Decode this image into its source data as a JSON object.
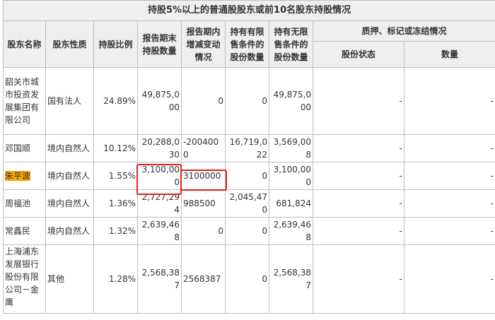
{
  "table": {
    "title": "持股5%以上的普通股股东或前10名股东持股情况",
    "headers": {
      "name": "股东名称",
      "nature": "股东性质",
      "ratio": "持股比例",
      "period_end": "报告期末持股数量",
      "change": "报告期内增减变动情况",
      "restricted": "持有有限售条件的股份数量",
      "unrestricted": "持有无限售条件的股份数量",
      "pledge": "质押、标记或冻结情况",
      "pledge_status": "股份状态",
      "pledge_qty": "数量"
    },
    "rows": [
      {
        "name": "韶关市城市投资发展集团有限公司",
        "nature": "国有法人",
        "ratio": "24.89%",
        "period_end": "49,875,000",
        "change": "0",
        "restricted": "0",
        "unrestricted": "49,875,000",
        "status": "-",
        "qty": "-"
      },
      {
        "name": "邓国顺",
        "nature": "境内自然人",
        "ratio": "10.12%",
        "period_end": "20,288,030",
        "change": "-2004000",
        "restricted": "16,719,022",
        "unrestricted": "3,569,008",
        "status": "-",
        "qty": "-"
      },
      {
        "name": "朱平波",
        "nature": "境内自然人",
        "ratio": "1.55%",
        "period_end": "3,100,000",
        "change": "3100000",
        "restricted": "0",
        "unrestricted": "3,100,000",
        "status": "-",
        "qty": "-"
      },
      {
        "name": "周福池",
        "nature": "境内自然人",
        "ratio": "1.36%",
        "period_end": "2,727,294",
        "change": "988500",
        "restricted": "2,045,470",
        "unrestricted": "681,824",
        "status": "-",
        "qty": "-"
      },
      {
        "name": "常鑫民",
        "nature": "境内自然人",
        "ratio": "1.32%",
        "period_end": "2,639,468",
        "change": "0",
        "restricted": "0",
        "unrestricted": "2,639,468",
        "status": "-",
        "qty": "-"
      },
      {
        "name": "上海浦东发展银行股份有限公司－金鹰",
        "nature": "其他",
        "ratio": "1.28%",
        "period_end": "2,568,387",
        "change": "2568387",
        "restricted": "0",
        "unrestricted": "2,568,387",
        "status": "-",
        "qty": "-"
      }
    ]
  },
  "colors": {
    "highlight": "#ffa500",
    "annotation_box": "#e02020",
    "header_bg": "#efefef",
    "border": "#bfbfbf"
  }
}
